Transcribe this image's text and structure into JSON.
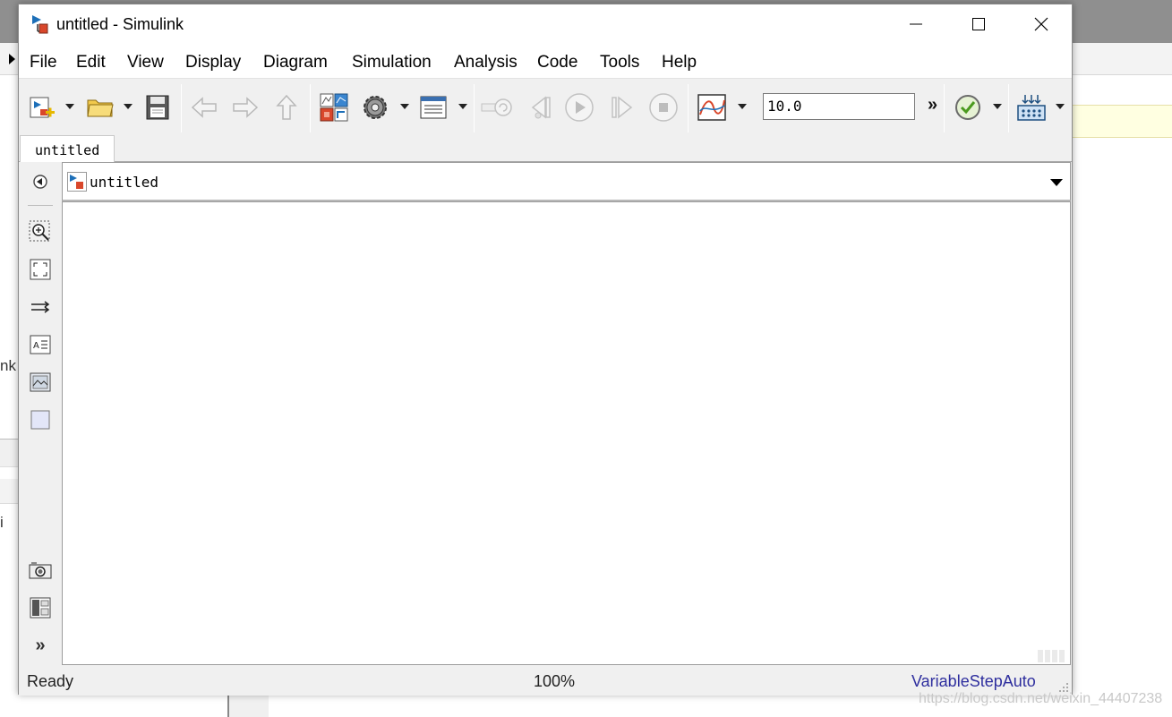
{
  "window": {
    "title": "untitled - Simulink"
  },
  "menubar": {
    "items": [
      "File",
      "Edit",
      "View",
      "Display",
      "Diagram",
      "Simulation",
      "Analysis",
      "Code",
      "Tools",
      "Help"
    ]
  },
  "toolbar": {
    "stop_time": "10.0",
    "more_label": "»",
    "icons": [
      "new-model-icon",
      "open-folder-icon",
      "save-icon",
      "back-icon",
      "forward-icon",
      "up-icon",
      "library-browser-icon",
      "model-config-gear-icon",
      "model-explorer-icon",
      "step-back-icon",
      "step-back-single-icon",
      "run-icon",
      "step-forward-icon",
      "stop-icon",
      "scope-icon",
      "model-advisor-check-icon",
      "build-icon"
    ]
  },
  "tabs": [
    {
      "label": "untitled"
    }
  ],
  "addressbar": {
    "path": "untitled"
  },
  "sidebar": {
    "icons": [
      "hide-explorer-icon",
      "zoom-icon",
      "fit-to-view-icon",
      "route-lines-icon",
      "annotation-icon",
      "image-icon",
      "area-icon",
      "snapshot-camera-icon",
      "model-browser-icon",
      "more-tools-icon"
    ],
    "more_label": "»"
  },
  "statusbar": {
    "status": "Ready",
    "zoom": "100%",
    "solver": "VariableStepAuto"
  },
  "background": {
    "left_text": "nk",
    "left_glyph": "i",
    "watermark": "https://blog.csdn.net/weixin_44407238"
  },
  "colors": {
    "window_bg": "#f0f0f0",
    "canvas_bg": "#ffffff",
    "solver_text": "#2e2e9e",
    "tooltip_bg": "#ffffe1"
  }
}
